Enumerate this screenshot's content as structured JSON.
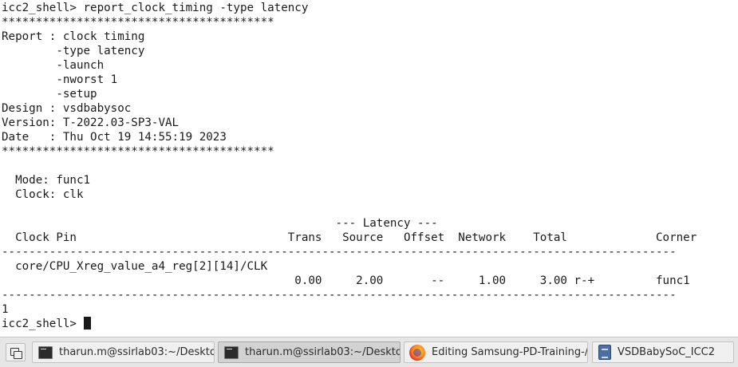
{
  "terminal": {
    "lines": [
      "icc2_shell> report_clock_timing -type latency",
      "****************************************",
      "Report : clock timing",
      "        -type latency",
      "        -launch",
      "        -nworst 1",
      "        -setup",
      "Design : vsdbabysoc",
      "Version: T-2022.03-SP3-VAL",
      "Date   : Thu Oct 19 14:55:19 2023",
      "****************************************",
      "",
      "  Mode: func1",
      "  Clock: clk",
      "",
      "                                                 --- Latency ---",
      "  Clock Pin                               Trans   Source   Offset  Network    Total             Corner",
      "---------------------------------------------------------------------------------------------------",
      "  core/CPU_Xreg_value_a4_reg[2][14]/CLK",
      "                                           0.00     2.00       --     1.00     3.00 r-+         func1",
      "---------------------------------------------------------------------------------------------------",
      "1"
    ],
    "prompt": "icc2_shell> "
  },
  "taskbar": {
    "items": [
      {
        "label": "tharun.m@ssirlab03:~/Deskto...",
        "icon": "terminal-icon",
        "active": false
      },
      {
        "label": "tharun.m@ssirlab03:~/Deskto...",
        "icon": "terminal-icon",
        "active": true
      },
      {
        "label": "Editing Samsung-PD-Training-/...",
        "icon": "firefox-icon",
        "active": false
      },
      {
        "label": "VSDBabySoC_ICC2",
        "icon": "document-icon",
        "active": false
      }
    ]
  }
}
